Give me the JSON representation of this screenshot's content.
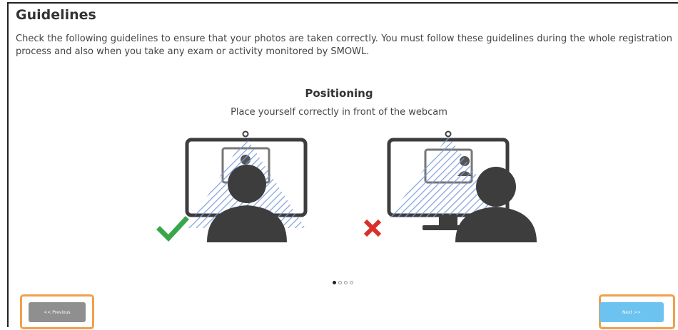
{
  "page": {
    "title": "Guidelines",
    "intro": "Check the following guidelines to ensure that your photos are taken correctly. You must follow these guidelines during the whole registration process and also when you take any exam or activity monitored by SMOWL."
  },
  "slide": {
    "title": "Positioning",
    "subtitle": "Place yourself correctly in front of the webcam",
    "correct_icon": "checkmark-icon",
    "incorrect_icon": "cross-icon",
    "current_index": 0,
    "total": 4
  },
  "nav": {
    "previous_label": "<< Previous",
    "next_label": "Next >>"
  },
  "colors": {
    "correct": "#3aa64a",
    "incorrect": "#d9302b",
    "hatch": "#7a9bd6",
    "highlight": "#f0a04b",
    "next_button": "#6cc3ef",
    "prev_button": "#8f8f8f"
  }
}
